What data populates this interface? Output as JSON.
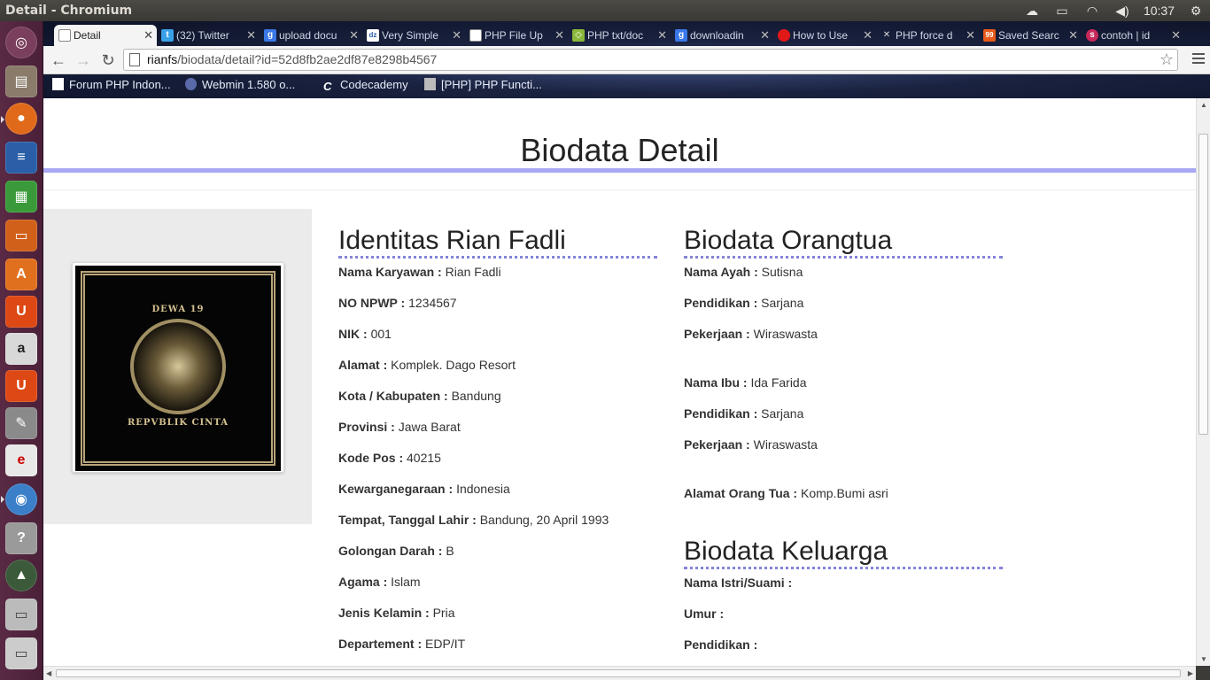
{
  "window": {
    "title": "Detail - Chromium",
    "clock": "10:37"
  },
  "tabs": [
    {
      "label": "Detail",
      "active": true
    },
    {
      "label": "(32) Twitter"
    },
    {
      "label": "upload docu"
    },
    {
      "label": "Very Simple"
    },
    {
      "label": "PHP File Up"
    },
    {
      "label": "PHP txt/doc"
    },
    {
      "label": "downloadin"
    },
    {
      "label": "How to Use"
    },
    {
      "label": "PHP force d"
    },
    {
      "label": "Saved Searc"
    },
    {
      "label": "contoh | id"
    }
  ],
  "address_bar": {
    "host": "rianfs",
    "path": "/biodata/detail?id=52d8fb2ae2df87e8298b4567"
  },
  "bookmarks": [
    {
      "label": "Forum PHP Indon..."
    },
    {
      "label": "Webmin 1.580 o..."
    },
    {
      "label": "Codecademy"
    },
    {
      "label": "[PHP] PHP Functi..."
    }
  ],
  "page": {
    "title": "Biodata Detail",
    "photo_caption_top": "DEWA 19",
    "photo_caption_bottom": "REPVBLIK CINTA",
    "identitas": {
      "heading": "Identitas Rian Fadli",
      "fields": [
        {
          "label": "Nama Karyawan :",
          "value": "Rian Fadli"
        },
        {
          "label": "NO NPWP :",
          "value": "1234567"
        },
        {
          "label": "NIK :",
          "value": "001"
        },
        {
          "label": "Alamat :",
          "value": "Komplek. Dago Resort"
        },
        {
          "label": "Kota / Kabupaten :",
          "value": "Bandung"
        },
        {
          "label": "Provinsi :",
          "value": "Jawa Barat"
        },
        {
          "label": "Kode Pos :",
          "value": "40215"
        },
        {
          "label": "Kewarganegaraan :",
          "value": "Indonesia"
        },
        {
          "label": "Tempat, Tanggal Lahir :",
          "value": "Bandung, 20 April 1993"
        },
        {
          "label": "Golongan Darah :",
          "value": "B"
        },
        {
          "label": "Agama :",
          "value": "Islam"
        },
        {
          "label": "Jenis Kelamin :",
          "value": "Pria"
        },
        {
          "label": "Departement :",
          "value": "EDP/IT"
        }
      ]
    },
    "orangtua": {
      "heading": "Biodata Orangtua",
      "fields": [
        {
          "label": "Nama Ayah :",
          "value": "Sutisna"
        },
        {
          "label": "Pendidikan :",
          "value": "Sarjana"
        },
        {
          "label": "Pekerjaan :",
          "value": "Wiraswasta"
        },
        {
          "label": "Nama Ibu :",
          "value": "Ida Farida"
        },
        {
          "label": "Pendidikan :",
          "value": "Sarjana"
        },
        {
          "label": "Pekerjaan :",
          "value": "Wiraswasta"
        },
        {
          "label": "Alamat Orang Tua :",
          "value": "Komp.Bumi asri"
        }
      ]
    },
    "keluarga": {
      "heading": "Biodata Keluarga",
      "fields": [
        {
          "label": "Nama Istri/Suami :",
          "value": ""
        },
        {
          "label": "Umur :",
          "value": ""
        },
        {
          "label": "Pendidikan :",
          "value": ""
        }
      ]
    }
  },
  "colors": {
    "title_rule": "#a8a8f4",
    "heading_dots": "#8484d8",
    "launcher": "#5a2a44"
  }
}
